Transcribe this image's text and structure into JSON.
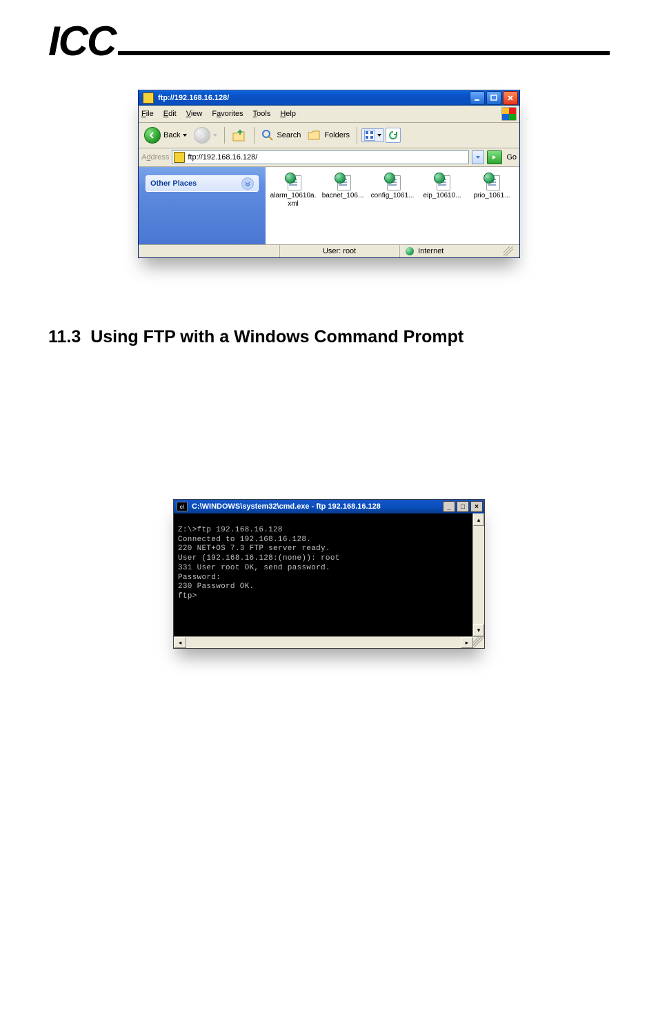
{
  "brand": "ICC",
  "explorer": {
    "title": "ftp://192.168.16.128/",
    "menu": {
      "file": "File",
      "edit": "Edit",
      "view": "View",
      "favorites": "Favorites",
      "tools": "Tools",
      "help": "Help"
    },
    "toolbar": {
      "back": "Back",
      "search": "Search",
      "folders": "Folders"
    },
    "address": {
      "label": "Address",
      "value": "ftp://192.168.16.128/",
      "go": "Go"
    },
    "sidebar": {
      "other_places": "Other Places"
    },
    "files": [
      {
        "label": "alarm_10610a.xml"
      },
      {
        "label": "bacnet_106..."
      },
      {
        "label": "config_1061..."
      },
      {
        "label": "eip_10610..."
      },
      {
        "label": "prio_1061..."
      }
    ],
    "status": {
      "user": "User: root",
      "zone": "Internet"
    }
  },
  "section": {
    "number": "11.3",
    "title": "Using FTP with a Windows Command Prompt"
  },
  "cmd": {
    "title": "C:\\WINDOWS\\system32\\cmd.exe - ftp 192.168.16.128",
    "lines": [
      "Z:\\>ftp 192.168.16.128",
      "Connected to 192.168.16.128.",
      "220 NET+OS 7.3 FTP server ready.",
      "User (192.168.16.128:(none)): root",
      "331 User root OK, send password.",
      "Password:",
      "230 Password OK.",
      "ftp>"
    ]
  }
}
